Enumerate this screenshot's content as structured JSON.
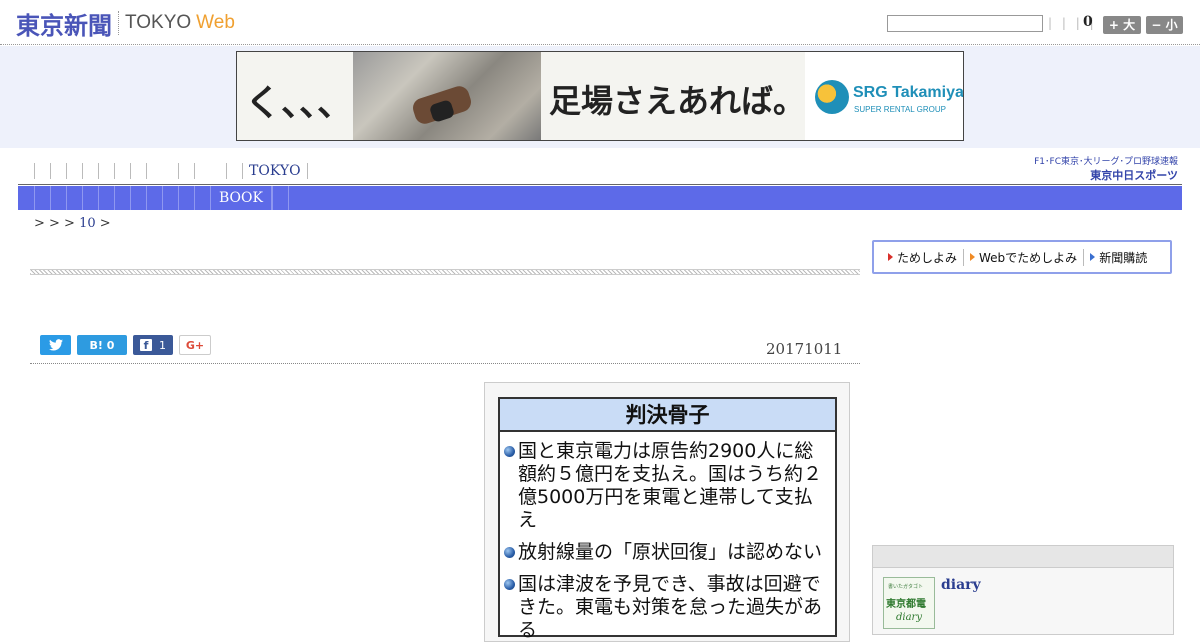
{
  "header": {
    "logo_jp": "東京新聞",
    "logo_tokyo": "TOKYO",
    "logo_web": "Web",
    "search_placeholder": "",
    "tick_bars": "| | | |",
    "count": "0",
    "size_plus_label": "+ 大",
    "size_minus_label": "− 小"
  },
  "banner": {
    "text_left": "く、、、",
    "text_main": "足場さえあれば。",
    "brand_name": "SRG Takamiya",
    "brand_sub": "SUPER RENTAL GROUP"
  },
  "nav_primary": {
    "item": "TOKYO"
  },
  "sponsor": {
    "line1": "F1･FC東京･大リーグ･プロ野球速報",
    "line2": "東京中日スポーツ"
  },
  "nav_secondary": {
    "item": "BOOK"
  },
  "breadcrumb": {
    "prefix": "> > >",
    "link": "10",
    "suffix": ">"
  },
  "article": {
    "date": "20171011",
    "share": {
      "twitter": "",
      "hatena": "B! 0",
      "facebook_count": "1",
      "gplus": "G+"
    },
    "figure": {
      "title": "判決骨子",
      "items": [
        "国と東京電力は原告約2900人に総額約５億円を支払え。国はうち約２億5000万円を東電と連帯して支払え",
        "放射線量の「原状回復」は認めない",
        "国は津波を予見でき、事故は回避できた。東電も対策を怠った過失がある"
      ]
    }
  },
  "sidebar": {
    "subscribe": [
      "ためしよみ",
      "Webでためしよみ",
      "新聞購読"
    ],
    "diary_thumb": {
      "line1": "書いたガタゴト",
      "line2": "東京都電",
      "line3": "diary"
    },
    "diary_title": "diary"
  }
}
